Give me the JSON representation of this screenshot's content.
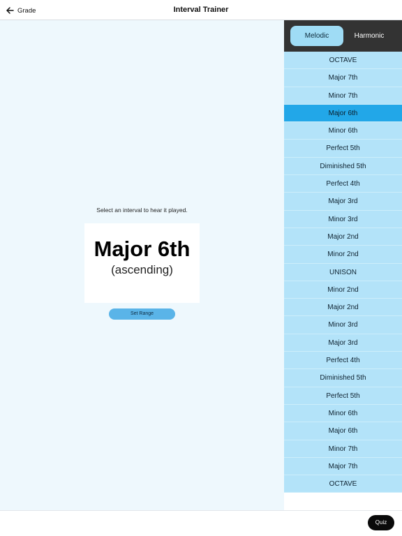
{
  "navbar": {
    "back_label": "Grade",
    "back_icon": "arrow-left-icon",
    "title": "Interval Trainer"
  },
  "main": {
    "prompt": "Select an interval to hear it played.",
    "card": {
      "interval": "Major 6th",
      "direction": "(ascending)"
    },
    "set_range_label": "Set Range"
  },
  "mode": {
    "options": [
      "Melodic",
      "Harmonic"
    ],
    "selected": "Melodic"
  },
  "intervals": {
    "items": [
      "OCTAVE",
      "Major 7th",
      "Minor 7th",
      "Major 6th",
      "Minor 6th",
      "Perfect 5th",
      "Diminished 5th",
      "Perfect 4th",
      "Major 3rd",
      "Minor 3rd",
      "Major 2nd",
      "Minor 2nd",
      "UNISON",
      "Minor 2nd",
      "Major 2nd",
      "Minor 3rd",
      "Major 3rd",
      "Perfect 4th",
      "Diminished 5th",
      "Perfect 5th",
      "Minor 6th",
      "Major 6th",
      "Minor 7th",
      "Major 7th",
      "OCTAVE"
    ],
    "selected_index": 3
  },
  "footer": {
    "quiz_label": "Quiz"
  },
  "colors": {
    "accent_selected": "#22a7e8",
    "list_bg": "#b3e3f9",
    "segment_bg": "#333333",
    "main_bg": "#eef8fd"
  }
}
